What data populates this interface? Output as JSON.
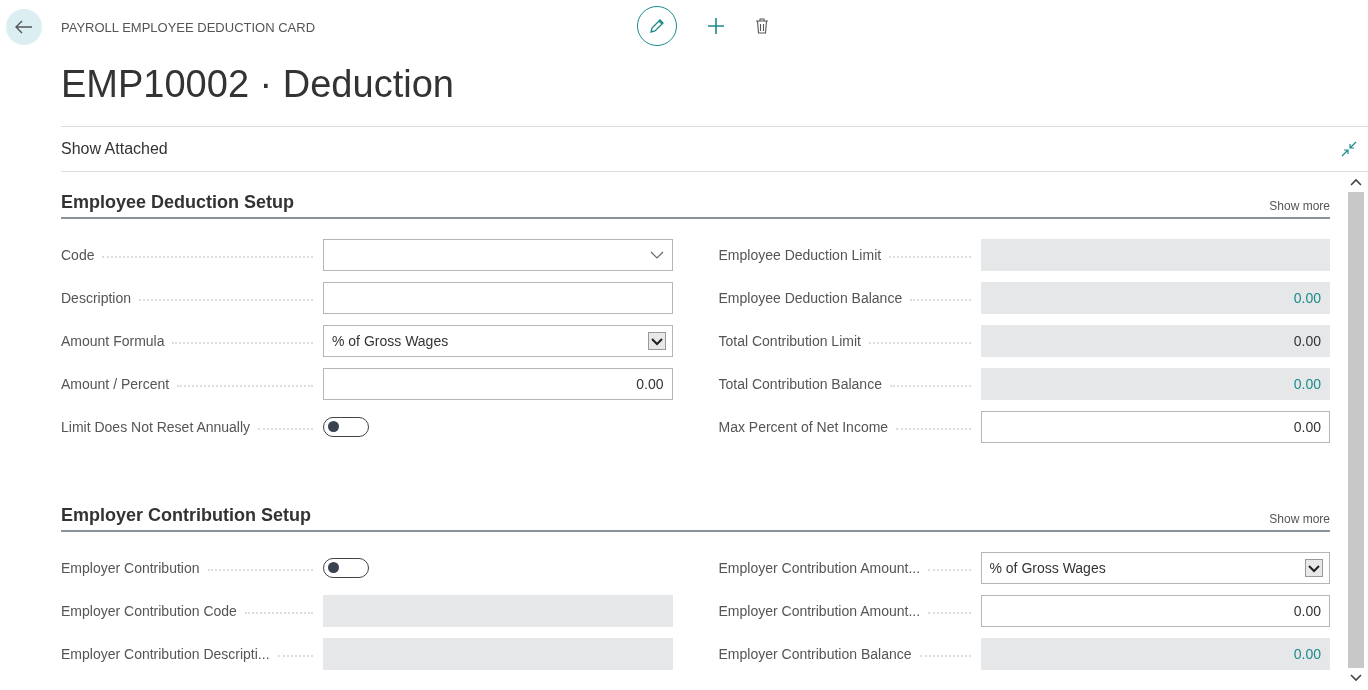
{
  "breadcrumb": "PAYROLL EMPLOYEE DEDUCTION CARD",
  "title": "EMP10002 · Deduction",
  "show_attached": "Show Attached",
  "sections": [
    {
      "heading": "Employee Deduction Setup",
      "show_more": "Show more",
      "left": [
        {
          "label": "Code",
          "kind": "lookup"
        },
        {
          "label": "Description",
          "kind": "text"
        },
        {
          "label": "Amount Formula",
          "kind": "select",
          "value": "% of Gross Wages"
        },
        {
          "label": "Amount / Percent",
          "kind": "number",
          "value": "0.00"
        },
        {
          "label": "Limit Does Not Reset Annually",
          "kind": "toggle",
          "on": false
        }
      ],
      "right": [
        {
          "label": "Employee Deduction Limit",
          "kind": "readonly"
        },
        {
          "label": "Employee Deduction Balance",
          "kind": "readonly",
          "value": "0.00",
          "drilldown": true
        },
        {
          "label": "Total Contribution Limit",
          "kind": "readonly",
          "value": "0.00",
          "drilldown": false
        },
        {
          "label": "Total Contribution Balance",
          "kind": "readonly",
          "value": "0.00",
          "drilldown": true
        },
        {
          "label": "Max Percent of Net Income",
          "kind": "number",
          "value": "0.00"
        }
      ]
    },
    {
      "heading": "Employer Contribution Setup",
      "show_more": "Show more",
      "left": [
        {
          "label": "Employer Contribution",
          "kind": "toggle",
          "on": false
        },
        {
          "label": "Employer Contribution Code",
          "kind": "readonly"
        },
        {
          "label": "Employer Contribution Descripti...",
          "kind": "readonly"
        }
      ],
      "right": [
        {
          "label": "Employer Contribution Amount...",
          "kind": "select",
          "value": "% of Gross Wages"
        },
        {
          "label": "Employer Contribution Amount...",
          "kind": "number",
          "value": "0.00"
        },
        {
          "label": "Employer Contribution Balance",
          "kind": "readonly",
          "value": "0.00",
          "drilldown": true
        }
      ]
    }
  ]
}
